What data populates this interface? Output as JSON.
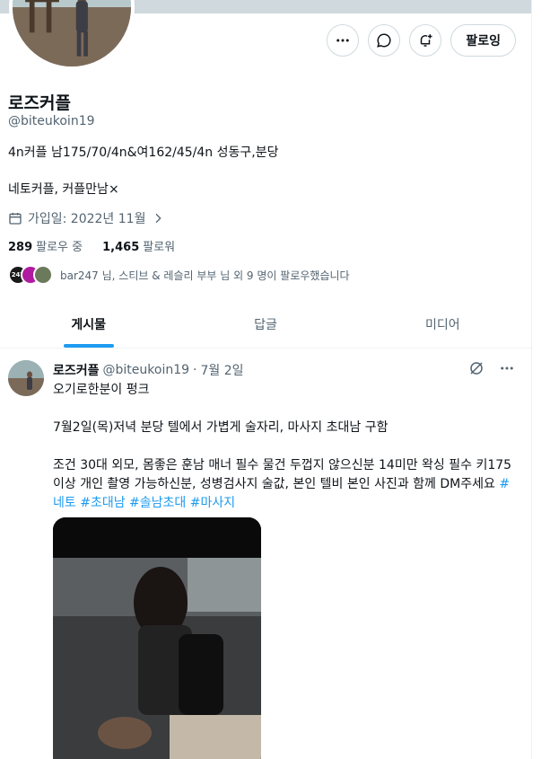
{
  "profile": {
    "display_name": "로즈커플",
    "handle": "@biteukoin19",
    "bio_line1": "4n커플 남175/70/4n&여162/45/4n 성동구,분당",
    "bio_line2": "네토커플, 커플만남×",
    "joined": "가입일: 2022년 11월",
    "following_count": "289",
    "following_label": "팔로우 중",
    "followers_count": "1,465",
    "followers_label": "팔로워",
    "followed_by_text": "bar247 님, 스티브 & 레슬리 부부 님 외 9 명이 팔로우했습니다",
    "mini_avatar_label": "247"
  },
  "actions": {
    "more_icon": "more-icon",
    "message_icon": "message-icon",
    "notify_icon": "bell-plus-icon",
    "follow_label": "팔로잉"
  },
  "tabs": [
    {
      "label": "게시물",
      "active": true
    },
    {
      "label": "답글",
      "active": false
    },
    {
      "label": "미디어",
      "active": false
    }
  ],
  "post": {
    "name": "로즈커플",
    "handle": "@biteukoin19",
    "separator": "·",
    "date": "7월 2일",
    "line1": "오기로한분이 펑크",
    "line2": "7월2일(목)저녁 분당 텔에서 가볍게 술자리, 마사지 초대남 구함",
    "line3": "조건 30대 외모, 몸좋은 훈남 매너 필수 물건 두껍지 않으신분 14미만 왁싱 필수 키175이상 개인 촬영 가능하신분, 성병검사지 술값, 본인 텔비 본인 사진과 함께 DM주세요",
    "hashtags": [
      "#네토",
      "#초대남",
      "#솔남초대",
      "#마사지"
    ]
  },
  "colors": {
    "accent": "#1d9bf0",
    "muted": "#536471",
    "border": "#cfd9de"
  }
}
